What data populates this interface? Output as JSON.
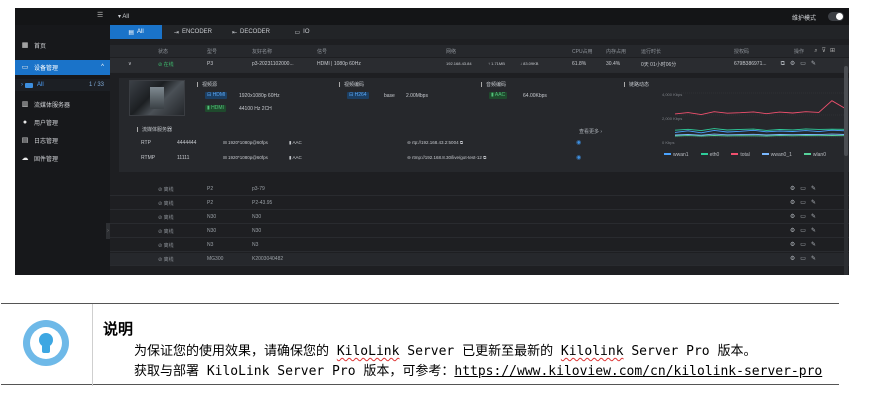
{
  "topbar": {
    "location": "All",
    "mode_label": "维护模式"
  },
  "sidebar": {
    "items": [
      {
        "label": "首页",
        "icon": "grid-icon"
      },
      {
        "label": "设备管理",
        "icon": "monitor-icon"
      },
      {
        "label": "流媒体服务器",
        "icon": "server-icon"
      },
      {
        "label": "用户管理",
        "icon": "user-icon"
      },
      {
        "label": "日志管理",
        "icon": "log-icon"
      },
      {
        "label": "固件管理",
        "icon": "cloud-icon"
      }
    ],
    "sub": {
      "label": "All",
      "count": "1 / 33"
    }
  },
  "tabs": [
    "All",
    "ENCODER",
    "DECODER",
    "IO"
  ],
  "table": {
    "headers": [
      "状态",
      "型号",
      "友好名称",
      "信号",
      "网络",
      "CPU占用",
      "内存占用",
      "运行时长",
      "授权码",
      "操作"
    ],
    "expanded_row": {
      "status": "在线",
      "model": "P3",
      "name": "p3-20231102000...",
      "signal": "HDMI | 1080p 60Hz",
      "ip": "192.168.43.84",
      "up": "1.71MB",
      "down": "83.09KB",
      "cpu": "61.8%",
      "mem": "30.4%",
      "uptime": "0天 01小时06分",
      "license": "679B386971..."
    },
    "rows": [
      {
        "status": "离线",
        "model": "P2",
        "name": "p3-79"
      },
      {
        "status": "离线",
        "model": "P2",
        "name": "P2-43.95"
      },
      {
        "status": "离线",
        "model": "N30",
        "name": "N30"
      },
      {
        "status": "离线",
        "model": "N30",
        "name": "N30"
      },
      {
        "status": "离线",
        "model": "N3",
        "name": "N3"
      },
      {
        "status": "离线",
        "model": "MG300",
        "name": "K2003040482"
      }
    ]
  },
  "detail": {
    "input_title": "视频源",
    "input_video_badge": "HDMI",
    "input_video": "1920x1080p 60Hz",
    "input_audio_badge": "HDMI",
    "input_audio": "44100 Hz    2CH",
    "video_enc_title": "视频编码",
    "video_codec": "H264",
    "video_profile": "base",
    "video_bitrate": "2.00Mbps",
    "audio_enc_title": "音频编码",
    "audio_codec": "AAC",
    "audio_bitrate": "64.00Kbps",
    "link_title": "链路动态",
    "stream_title": "流媒体服务器",
    "more": "查看更多 ›",
    "streams": [
      {
        "proto": "RTP",
        "port": "4444444",
        "res": "1920*1080p@60fps",
        "audio": "AAC",
        "url": "rtp://192.168.43.2:5004"
      },
      {
        "proto": "RTMP",
        "port": "11111",
        "res": "1920*1080p@60fps",
        "audio": "AAC",
        "url": "rtmp://192.168.8.30/live/got-test-12"
      }
    ],
    "chart_axis": [
      "4,000 Kbps",
      "2,000 Kbps",
      "0 Kbps"
    ]
  },
  "chart_data": {
    "type": "line",
    "title": "链路动态",
    "ylabel": "",
    "xlabel": "",
    "ylim": [
      0,
      4000
    ],
    "yticks": [
      "0 Kbps",
      "2,000 Kbps",
      "4,000 Kbps"
    ],
    "series": [
      {
        "name": "wwan1",
        "color": "#4aa3ff",
        "values": [
          420,
          560,
          380,
          600,
          450,
          520,
          610,
          470,
          540,
          500,
          580,
          490,
          620,
          560
        ]
      },
      {
        "name": "eth0",
        "color": "#2ecc9a",
        "values": [
          620,
          700,
          580,
          760,
          640,
          690,
          720,
          600,
          680,
          650,
          740,
          690,
          710,
          700
        ]
      },
      {
        "name": "total",
        "color": "#f0506e",
        "values": [
          2100,
          2220,
          2040,
          2300,
          2160,
          2210,
          2280,
          2120,
          2260,
          2180,
          2300,
          2240,
          3300,
          2600
        ]
      },
      {
        "name": "wwan0_1",
        "color": "#7ab8ff",
        "values": [
          180,
          240,
          160,
          260,
          200,
          220,
          250,
          190,
          230,
          210,
          240,
          220,
          260,
          230
        ]
      },
      {
        "name": "wlan0",
        "color": "#56d39b",
        "values": [
          90,
          130,
          80,
          140,
          100,
          120,
          110,
          95,
          125,
          105,
          130,
          115,
          140,
          120
        ]
      }
    ]
  },
  "note": {
    "title": "说明",
    "line1": "为保证您的使用效果，请确保您的 KiloLink Server 已更新至最新的 Kilolink Server Pro 版本。",
    "line2_prefix": "获取与部署 KiloLink Server Pro 版本，可参考：",
    "line2_link": "https://www.kiloview.com/cn/kilolink-server-pro"
  }
}
